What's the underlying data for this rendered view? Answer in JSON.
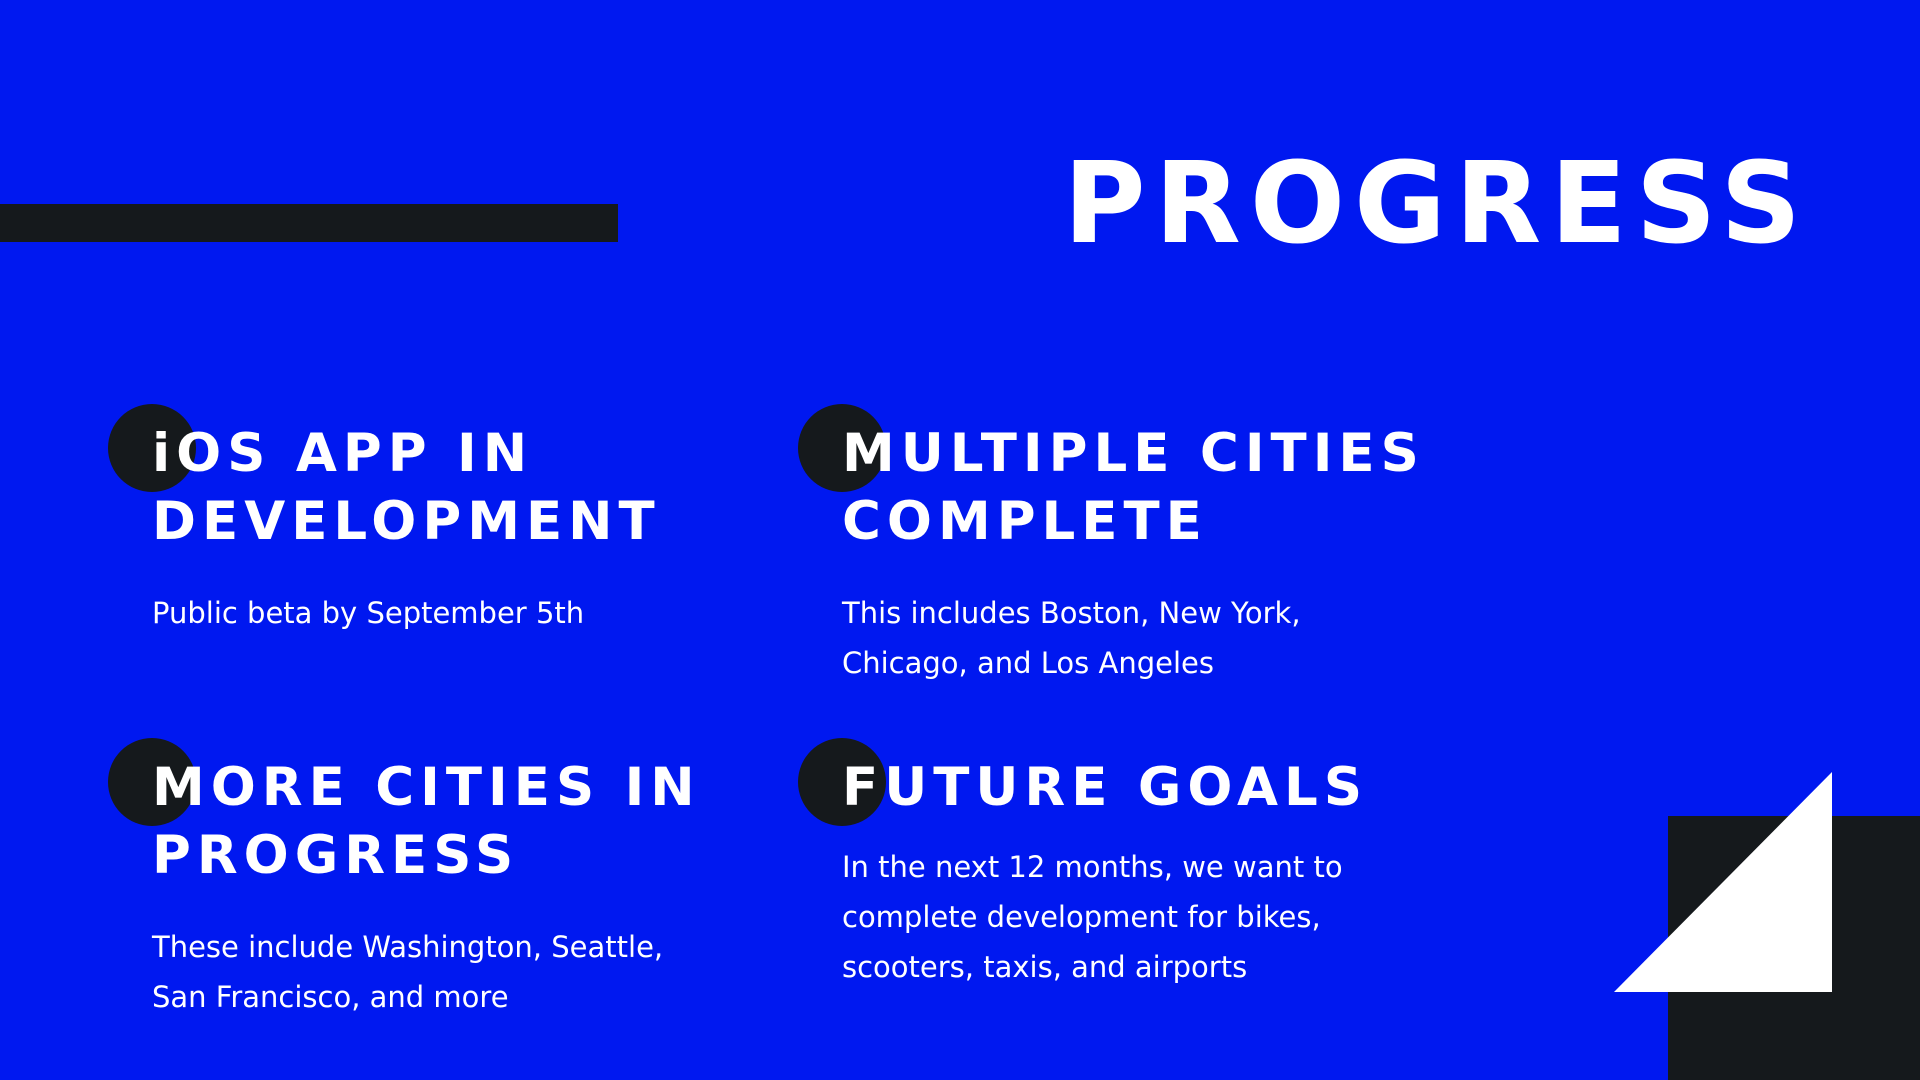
{
  "slide": {
    "title": "PROGRESS",
    "items": [
      {
        "title_line1": "iOS APP IN",
        "title_line2": "DEVELOPMENT",
        "text_line1": "Public beta by September 5th"
      },
      {
        "title_line1": "MULTIPLE CITIES",
        "title_line2": "COMPLETE",
        "text_line1": "This includes Boston, New York,",
        "text_line2": "Chicago, and Los Angeles"
      },
      {
        "title_line1": "MORE CITIES IN",
        "title_line2": "PROGRESS",
        "text_line1": "These include Washington, Seattle,",
        "text_line2": "San Francisco, and more"
      },
      {
        "title_line1": "FUTURE GOALS",
        "text_line1": "In the next 12 months, we want to",
        "text_line2": "complete development for bikes,",
        "text_line3": "scooters, taxis, and airports"
      }
    ]
  },
  "colors": {
    "background": "#0018f0",
    "dark": "#15191c",
    "text": "#ffffff"
  }
}
